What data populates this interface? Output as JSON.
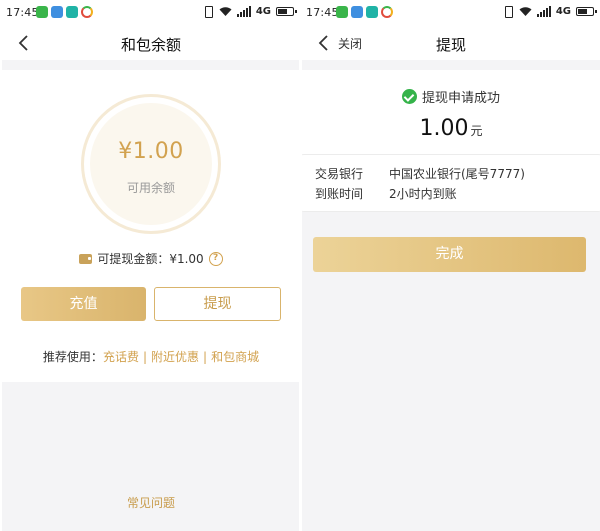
{
  "left_screen": {
    "status_bar": {
      "time": "17:45",
      "network": "4G"
    },
    "nav": {
      "title": "和包余额"
    },
    "balance": {
      "amount": "¥1.00",
      "label": "可用余额"
    },
    "withdrawable": {
      "text": "可提现金额：¥1.00",
      "help": "?"
    },
    "buttons": {
      "recharge": "充值",
      "withdraw": "提现"
    },
    "recommend": {
      "prefix": "推荐使用：",
      "links": [
        "充话费",
        "附近优惠",
        "和包商城"
      ],
      "separator": "|"
    },
    "faq": "常见问题"
  },
  "right_screen": {
    "status_bar": {
      "time": "17:45",
      "network": "4G"
    },
    "nav": {
      "close": "关闭",
      "title": "提现"
    },
    "result": {
      "status": "提现申请成功",
      "amount": "1.00",
      "unit": "元"
    },
    "details": [
      {
        "key": "交易银行",
        "value": "中国农业银行(尾号7777)"
      },
      {
        "key": "到账时间",
        "value": "2小时内到账"
      }
    ],
    "done_button": "完成"
  },
  "colors": {
    "gold": "#d2a24f",
    "button_gradient_start": "#e8c786",
    "success_green": "#35b34a",
    "background": "#f4f4f6"
  }
}
